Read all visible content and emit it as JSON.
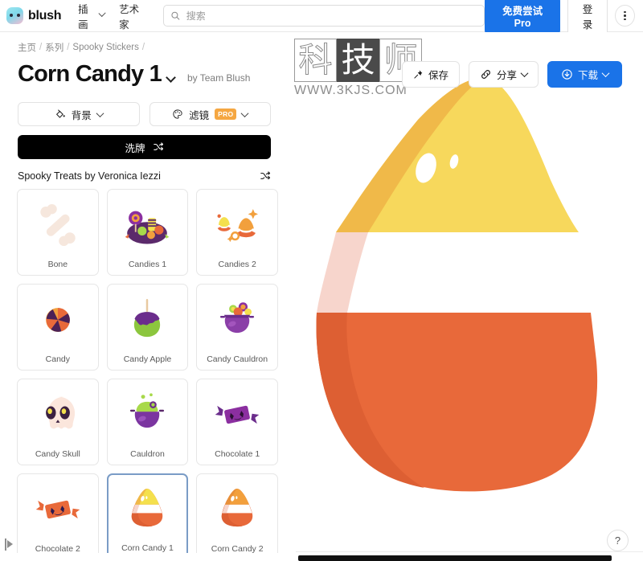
{
  "topnav": {
    "brand": "blush",
    "links": [
      {
        "label": "插画",
        "has_caret": true,
        "name": "nav-illustrations"
      },
      {
        "label": "艺术家",
        "has_caret": false,
        "name": "nav-artists"
      }
    ],
    "search": {
      "placeholder": "搜索",
      "value": "",
      "icon": "search-icon"
    },
    "pro_button": "免费尝试 Pro",
    "login_button": "登录",
    "kebab": "more-options"
  },
  "breadcrumb": {
    "items": [
      "主页",
      "系列",
      "Spooky Stickers"
    ],
    "separator": "/"
  },
  "header": {
    "title": "Corn Candy 1",
    "byline": "by Team Blush",
    "actions": [
      {
        "label": "保存",
        "icon": "pin-icon",
        "caret": false,
        "primary": false,
        "name": "save-button"
      },
      {
        "label": "分享",
        "icon": "link-icon",
        "caret": true,
        "primary": false,
        "name": "share-button"
      },
      {
        "label": "下载",
        "icon": "download-cloud-icon",
        "caret": true,
        "primary": true,
        "name": "download-button"
      }
    ]
  },
  "tools": {
    "background": {
      "label": "背景",
      "icon": "paint-bucket-icon"
    },
    "filter": {
      "label": "滤镜",
      "icon": "palette-icon",
      "badge": "PRO"
    },
    "shuffle": {
      "label": "洗牌",
      "icon": "shuffle-icon"
    }
  },
  "pack": {
    "title": "Spooky Treats by Veronica Iezzi",
    "shuffle_icon": "shuffle-icon"
  },
  "grid": {
    "items": [
      {
        "label": "Bone",
        "art": "bone",
        "selected": false
      },
      {
        "label": "Candies 1",
        "art": "candies1",
        "selected": false
      },
      {
        "label": "Candies 2",
        "art": "candies2",
        "selected": false
      },
      {
        "label": "Candy",
        "art": "candy",
        "selected": false
      },
      {
        "label": "Candy Apple",
        "art": "candyapple",
        "selected": false
      },
      {
        "label": "Candy Cauldron",
        "art": "cauldronfull",
        "selected": false
      },
      {
        "label": "Candy Skull",
        "art": "skull",
        "selected": false
      },
      {
        "label": "Cauldron",
        "art": "cauldron",
        "selected": false
      },
      {
        "label": "Chocolate 1",
        "art": "chocolate1",
        "selected": false
      },
      {
        "label": "Chocolate 2",
        "art": "chocolate2",
        "selected": false
      },
      {
        "label": "Corn Candy 1",
        "art": "corn1",
        "selected": true
      },
      {
        "label": "Corn Candy 2",
        "art": "corn2",
        "selected": false
      }
    ]
  },
  "canvas": {
    "illustration": "corn-candy-1",
    "colors": {
      "yellow": "#F7D85C",
      "yellow_shade": "#F0B949",
      "white": "#FFFFFF",
      "pink_shade": "#F7D5CC",
      "orange": "#E8693A",
      "orange_shade": "#E8693A"
    },
    "watermark": {
      "chars": [
        "科",
        "技",
        "师"
      ],
      "url": "WWW.3KJS.COM"
    },
    "help_button": "?"
  },
  "collapse": {
    "icon": "expand-panel-icon"
  },
  "theme": {
    "accent": "#1a73e8",
    "pro_badge": "#f5a742",
    "black": "#000000",
    "selected_border": "#7a9cc6"
  }
}
